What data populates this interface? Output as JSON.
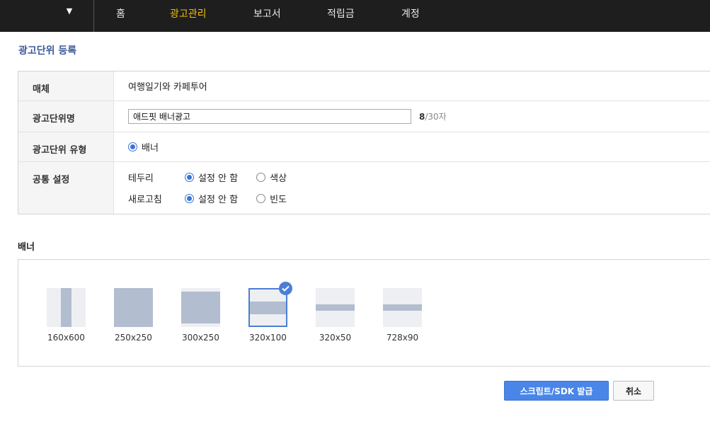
{
  "nav": {
    "items": [
      {
        "label": "홈"
      },
      {
        "label": "광고관리",
        "active": true
      },
      {
        "label": "보고서"
      },
      {
        "label": "적립금"
      },
      {
        "label": "계정"
      }
    ],
    "menu_caret": "▼",
    "active_color": "#f5c000"
  },
  "page": {
    "title": "광고단위 등록"
  },
  "form": {
    "media": {
      "label": "매체",
      "value": "여행일기와 카페투어"
    },
    "unit_name": {
      "label": "광고단위명",
      "value": "애드핏 배너광고",
      "count_current": "8",
      "count_suffix": "/30자"
    },
    "unit_type": {
      "label": "광고단위 유형",
      "option": "배너",
      "selected": true
    },
    "common": {
      "label": "공통 설정",
      "border": {
        "label": "테두리",
        "options": [
          "설정 안 함",
          "색상"
        ],
        "selected": "설정 안 함"
      },
      "refresh": {
        "label": "새로고침",
        "options": [
          "설정 안 함",
          "빈도"
        ],
        "selected": "설정 안 함"
      }
    }
  },
  "banner": {
    "section_title": "배너",
    "sizes": [
      {
        "label": "160x600"
      },
      {
        "label": "250x250"
      },
      {
        "label": "300x250"
      },
      {
        "label": "320x100",
        "selected": true
      },
      {
        "label": "320x50"
      },
      {
        "label": "728x90"
      }
    ]
  },
  "buttons": {
    "submit": "스크립트/SDK 발급",
    "cancel": "취소"
  },
  "colors": {
    "accent": "#4a86e8",
    "topbar": "#1e1e1e",
    "title": "#3d5a98"
  }
}
